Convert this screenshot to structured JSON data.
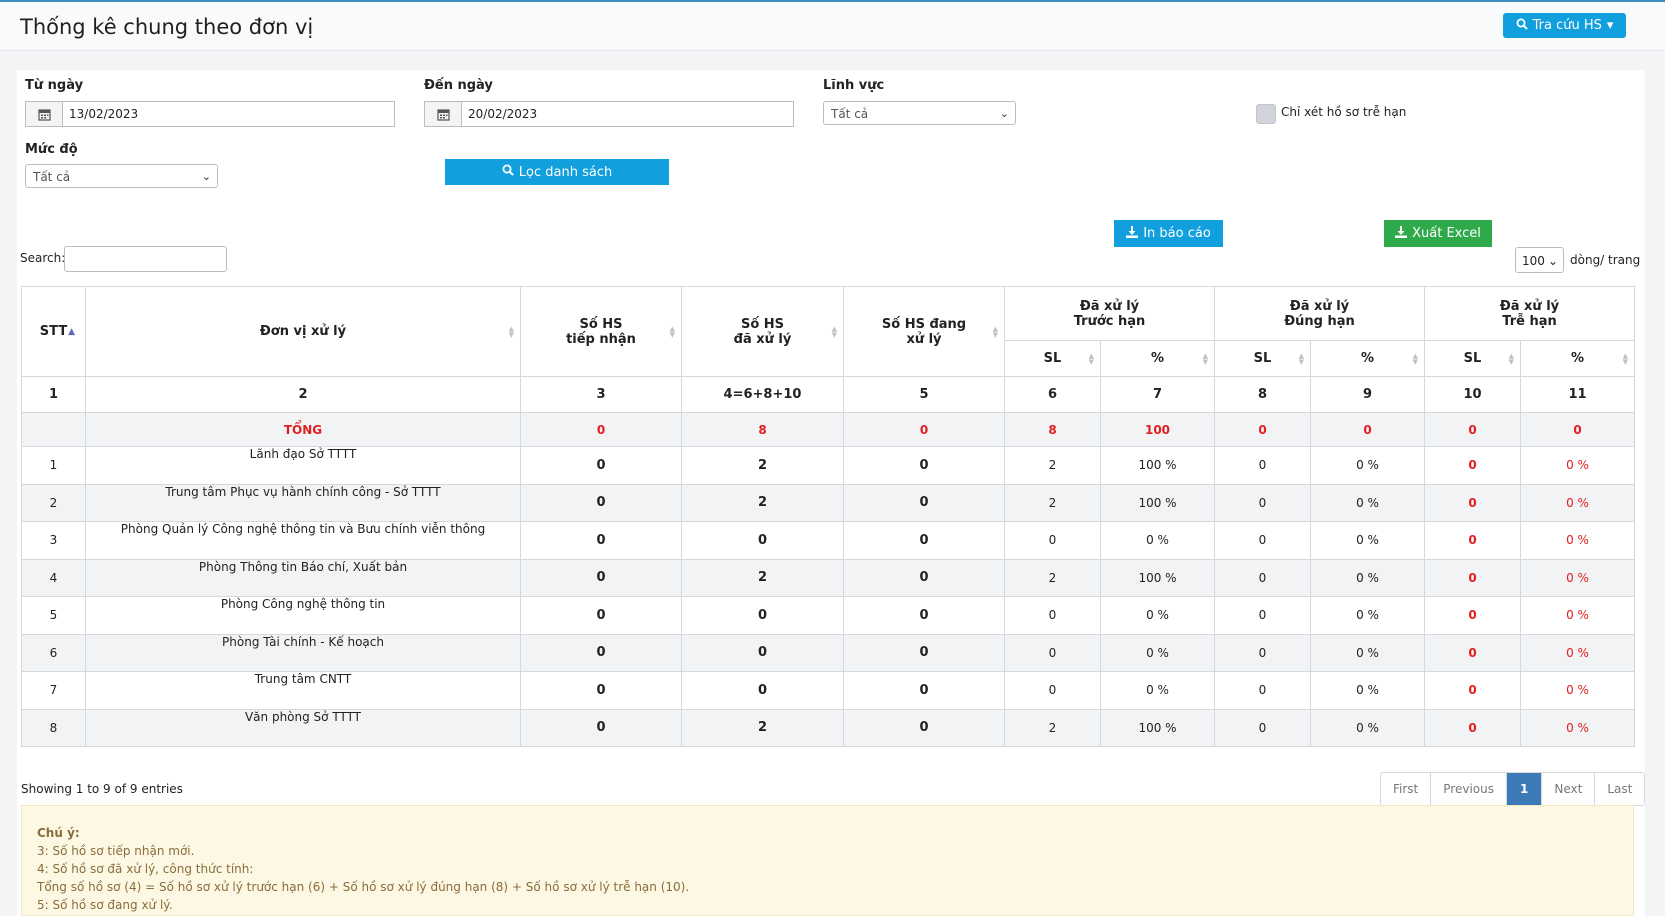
{
  "header": {
    "title": "Thống kê chung theo đơn vị",
    "lookup_label": "Tra cứu HS"
  },
  "filters": {
    "from_label": "Từ ngày",
    "from_value": "13/02/2023",
    "to_label": "Đến ngày",
    "to_value": "20/02/2023",
    "field_label": "Lĩnh vực",
    "field_value": "Tất cả",
    "late_only_label": "Chỉ xét hồ sơ trễ hạn",
    "level_label": "Mức độ",
    "level_value": "Tất cả",
    "filter_button": "Lọc danh sách"
  },
  "actions": {
    "print_label": "In báo cáo",
    "excel_label": "Xuất Excel"
  },
  "table_controls": {
    "search_label": "Search:",
    "page_size": "100",
    "page_size_suffix": "dòng/ trang"
  },
  "table": {
    "headers": {
      "stt": "STT",
      "unit": "Đơn vị xử lý",
      "received_1": "Số HS",
      "received_2": "tiếp nhận",
      "processed_1": "Số HS",
      "processed_2": "đã xử lý",
      "processing_1": "Số HS đang",
      "processing_2": "xử lý",
      "early_1": "Đã xử lý",
      "early_2": "Trước hạn",
      "ontime_1": "Đã xử lý",
      "ontime_2": "Đúng hạn",
      "late_1": "Đã xử lý",
      "late_2": "Trễ hạn",
      "sl": "SL",
      "pct": "%"
    },
    "index_row": [
      "1",
      "2",
      "3",
      "4=6+8+10",
      "5",
      "6",
      "7",
      "8",
      "9",
      "10",
      "11"
    ],
    "total_row": [
      "",
      "TỔNG",
      "0",
      "8",
      "0",
      "8",
      "100",
      "0",
      "0",
      "0",
      "0"
    ],
    "rows": [
      [
        "1",
        "Lãnh đạo Sở TTTT",
        "0",
        "2",
        "0",
        "2",
        "100 %",
        "0",
        "0 %",
        "0",
        "0 %"
      ],
      [
        "2",
        "Trung tâm Phục vụ hành chính công - Sở TTTT",
        "0",
        "2",
        "0",
        "2",
        "100 %",
        "0",
        "0 %",
        "0",
        "0 %"
      ],
      [
        "3",
        "Phòng Quản lý Công nghệ thông tin và Bưu chính viễn thông",
        "0",
        "0",
        "0",
        "0",
        "0 %",
        "0",
        "0 %",
        "0",
        "0 %"
      ],
      [
        "4",
        "Phòng Thông tin Báo chí, Xuất bản",
        "0",
        "2",
        "0",
        "2",
        "100 %",
        "0",
        "0 %",
        "0",
        "0 %"
      ],
      [
        "5",
        "Phòng Công nghệ thông tin",
        "0",
        "0",
        "0",
        "0",
        "0 %",
        "0",
        "0 %",
        "0",
        "0 %"
      ],
      [
        "6",
        "Phòng Tài chính - Kế hoạch",
        "0",
        "0",
        "0",
        "0",
        "0 %",
        "0",
        "0 %",
        "0",
        "0 %"
      ],
      [
        "7",
        "Trung tâm CNTT",
        "0",
        "0",
        "0",
        "0",
        "0 %",
        "0",
        "0 %",
        "0",
        "0 %"
      ],
      [
        "8",
        "Văn phòng Sở TTTT",
        "0",
        "2",
        "0",
        "2",
        "100 %",
        "0",
        "0 %",
        "0",
        "0 %"
      ]
    ]
  },
  "footer": {
    "showing": "Showing 1 to 9 of 9 entries",
    "pager": [
      "First",
      "Previous",
      "1",
      "Next",
      "Last"
    ]
  },
  "note": {
    "title": "Chú ý:",
    "lines": [
      "3: Số hồ sơ tiếp nhận mới.",
      "4: Số hồ sơ đã xử lý, công thức tính:",
      "Tổng số hồ sơ (4) = Số hồ sơ xử lý trước hạn (6) + Số hồ sơ xử lý đúng hạn (8) + Số hồ sơ xử lý trễ hạn (10).",
      "5: Số hồ sơ đang xử lý."
    ]
  },
  "colors": {
    "primary": "#129fde",
    "success": "#2eaa4a",
    "danger": "#e02020",
    "pager_active": "#3c7ab8"
  }
}
